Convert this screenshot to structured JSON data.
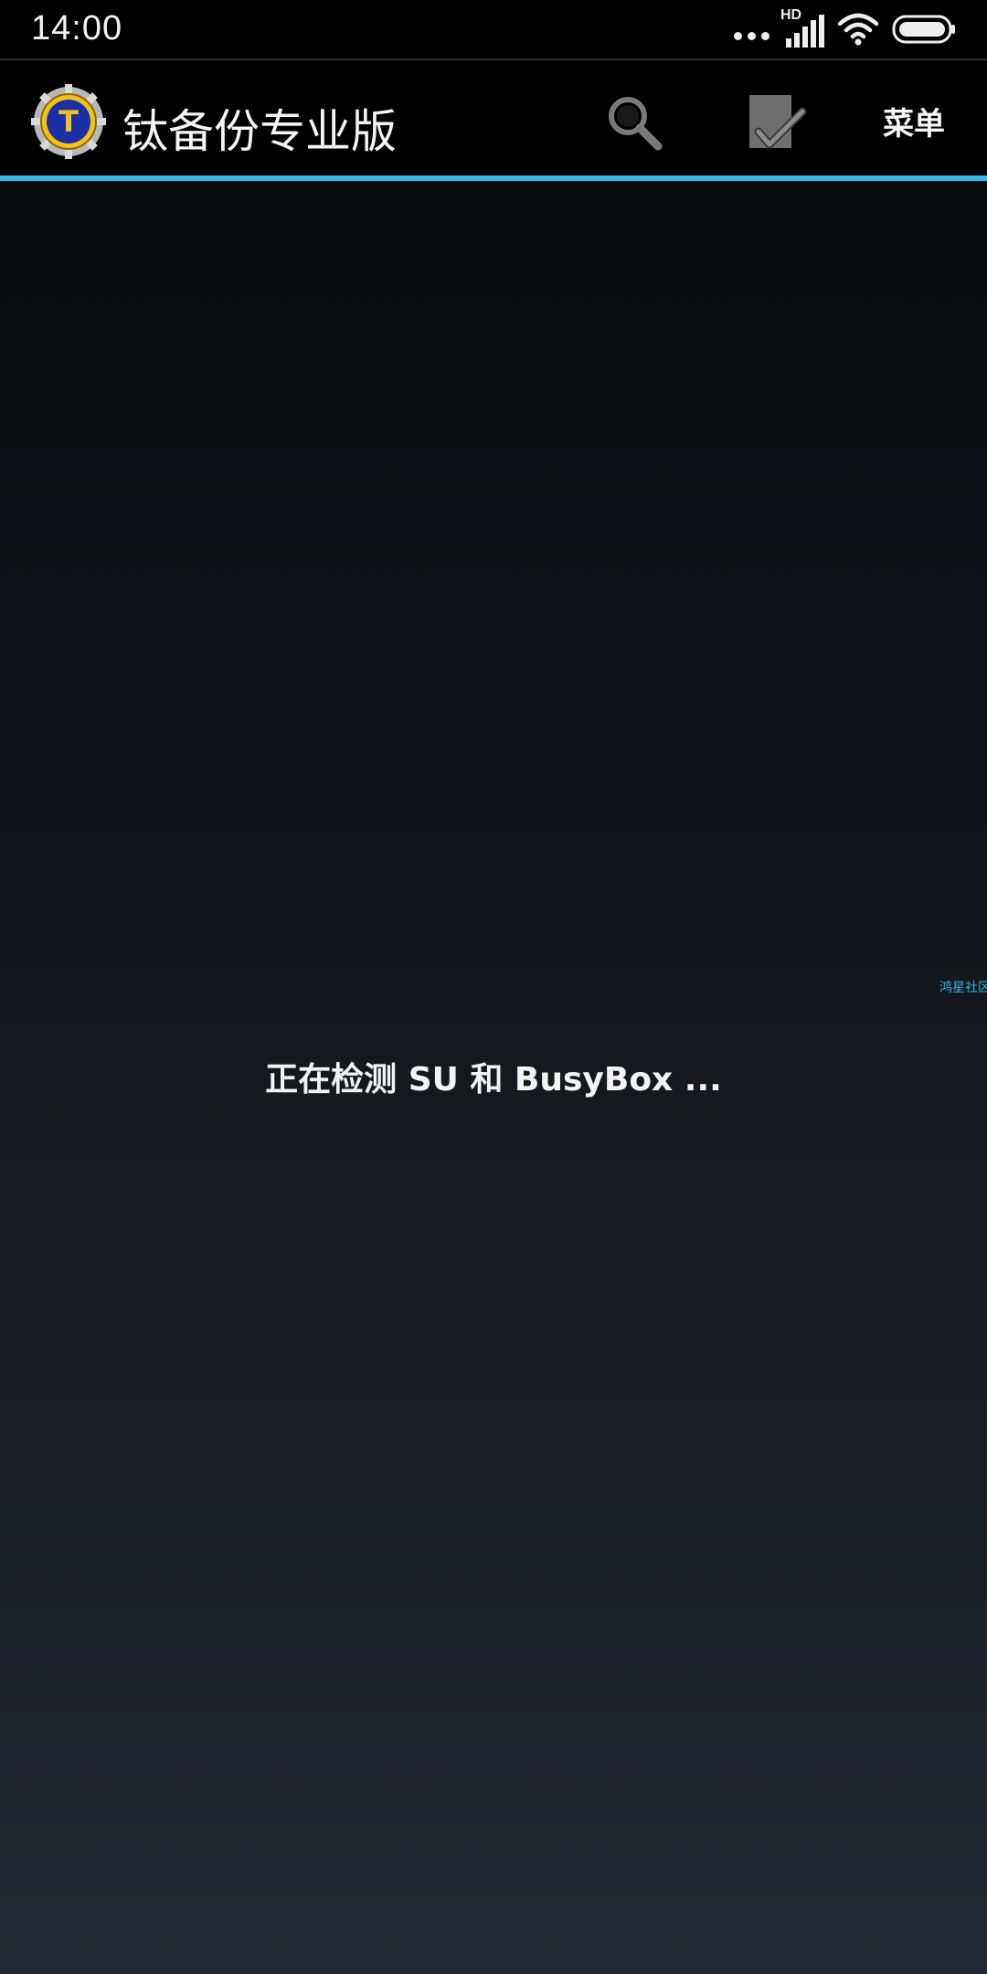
{
  "status_bar": {
    "time": "14:00",
    "network_badge": "HD",
    "icons": [
      "more-dots-icon",
      "cellular-signal-icon",
      "wifi-icon",
      "battery-icon"
    ]
  },
  "app_bar": {
    "title": "钛备份专业版",
    "logo_icon": "titanium-backup-logo-icon",
    "search_icon": "search-icon",
    "select_icon": "checkmark-select-icon",
    "menu_label": "菜单",
    "accent_color": "#33b5e5"
  },
  "main": {
    "status_message": "正在检测 SU 和 BusyBox ...",
    "watermark": "鸿星社区"
  }
}
